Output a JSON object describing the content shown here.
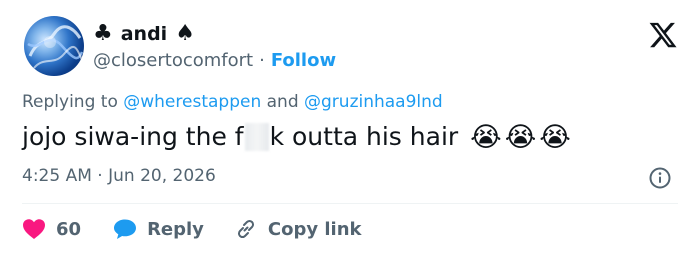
{
  "user": {
    "display_name": "andi",
    "suit_left": "♣",
    "suit_right": "♠",
    "handle": "@closertocomfort",
    "separator": "·",
    "follow_label": "Follow"
  },
  "replying": {
    "prefix": "Replying to",
    "mention_1": "@wherestappen",
    "conjunction": "and",
    "mention_2": "@gruzinhaa9lnd"
  },
  "tweet": {
    "text_before": "jojo siwa-ing the f",
    "text_after": "k outta his hair",
    "emojis": [
      "😭",
      "😭",
      "😭"
    ]
  },
  "meta": {
    "time": "4:25 AM",
    "separator": "·",
    "date": "Jun 20, 2026"
  },
  "actions": {
    "like_count": "60",
    "reply_label": "Reply",
    "copy_label": "Copy link"
  },
  "colors": {
    "accent": "#1d9bf0",
    "like": "#f91880",
    "muted": "#536471",
    "text": "#0f1419"
  },
  "icons": {
    "x_logo": "x-logo-icon",
    "info": "info-icon",
    "heart": "heart-icon",
    "reply": "reply-bubble-icon",
    "link": "link-icon"
  }
}
